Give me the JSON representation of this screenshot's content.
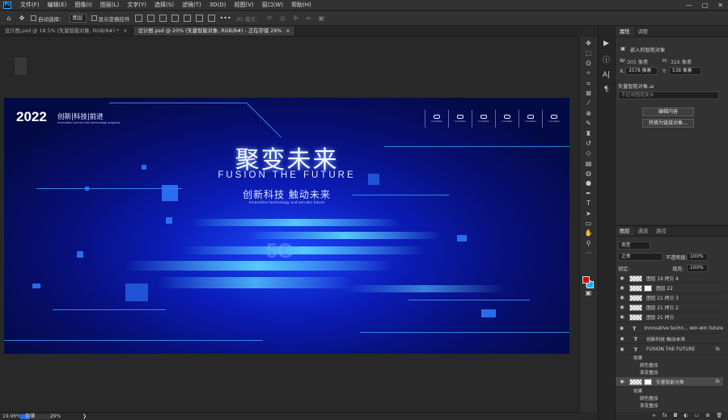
{
  "menubar": {
    "logo": "Ps",
    "items": [
      "文件(F)",
      "编辑(E)",
      "图像(I)",
      "图层(L)",
      "文字(Y)",
      "选择(S)",
      "滤镜(T)",
      "3D(D)",
      "视图(V)",
      "窗口(W)",
      "帮助(H)"
    ],
    "controls": [
      "—",
      "▢",
      "✕"
    ]
  },
  "options": {
    "auto_select": "自动选择：",
    "layer_select": "图层",
    "show_transform": "显示变换控件",
    "mode3d": "3D 模式："
  },
  "tabs": [
    {
      "label": "设计图.psd @ 18.5% (矢量智能对象, RGB/8#) *",
      "close": "×"
    },
    {
      "label": "设计图.psd @ 20% (矢量智能对象, RGB/8#) - 正在存储 29%",
      "close": "×"
    }
  ],
  "banner": {
    "year": "2022",
    "tagline": "创新|科技|前进",
    "tagline_sub": "innovation science and technology progress",
    "title": "聚变未来",
    "subtitle": "FUSION THE FUTURE",
    "slogan": "创新科技  触动未来",
    "english": "Innovative technology and win-win future",
    "fiveg": "5G",
    "icons": [
      "Innovative",
      "Innovative",
      "Innovative",
      "Innovative",
      "Innovative",
      "Innovative"
    ]
  },
  "properties": {
    "tab1": "属性",
    "tab2": "调整",
    "header": "嵌入的智能对象",
    "w_label": "W:",
    "w_value": "305 像素",
    "h_label": "H:",
    "h_value": "316 像素",
    "x_label": "X:",
    "x_value": "3578 像素",
    "y_label": "Y:",
    "y_value": "538 像素",
    "file_label": "矢量智能对象.ai",
    "comp": "不应用图层复合",
    "edit_btn": "编辑内容",
    "convert_btn": "转换为链接对象..."
  },
  "layers_panel": {
    "tabs": [
      "图层",
      "通道",
      "路径"
    ],
    "kind": "类型",
    "blend": "正常",
    "opacity_label": "不透明度:",
    "opacity": "100%",
    "lock_label": "锁定:",
    "fill_label": "填充:",
    "fill": "100%",
    "layers": [
      {
        "name": "图层 19 拷贝 4",
        "kind": "thumb",
        "fx": ""
      },
      {
        "name": "图层 22",
        "kind": "mask",
        "fx": ""
      },
      {
        "name": "图层 21 拷贝 3",
        "kind": "thumb",
        "fx": ""
      },
      {
        "name": "图层 21 拷贝 2",
        "kind": "thumb",
        "fx": ""
      },
      {
        "name": "图层 21 拷贝",
        "kind": "thumb",
        "fx": ""
      },
      {
        "name": "Innovative techn... win-win future",
        "kind": "text",
        "fx": ""
      },
      {
        "name": "创新科技  触动未来",
        "kind": "text",
        "fx": ""
      },
      {
        "name": "FUSION THE FUTURE",
        "kind": "text",
        "fx": "fx"
      }
    ],
    "effects1": [
      "效果",
      "颜色叠加",
      "渐变叠加"
    ],
    "smart_layer": {
      "name": "矢量智能对象",
      "fx": "fx"
    },
    "effects2": [
      "效果",
      "颜色叠加",
      "渐变叠加"
    ]
  },
  "status": {
    "zoom": "19.96%",
    "save": "存储",
    "save_pct": "29%",
    "save_progress": 0.29
  }
}
